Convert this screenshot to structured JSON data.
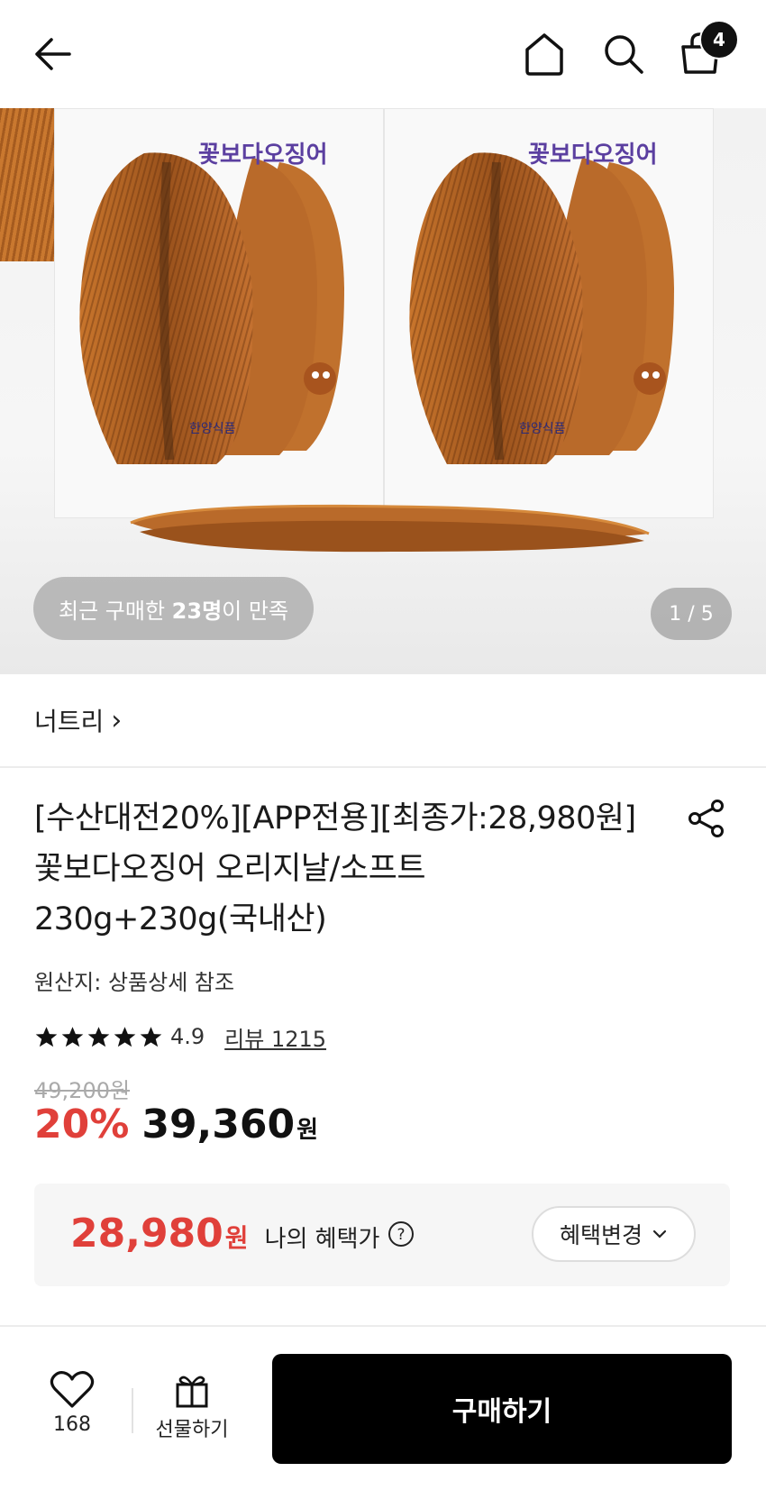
{
  "header": {
    "cart_count": "4"
  },
  "gallery": {
    "satisfied_prefix": "최근 구매한 ",
    "satisfied_count": "23명",
    "satisfied_suffix": "이 만족",
    "page_indicator": "1 / 5",
    "pack_brand_text": "꽃보다오징어",
    "pack_maker_text": "한양식품"
  },
  "brand": {
    "name": "너트리",
    "chevron": "›"
  },
  "product": {
    "title": "[수산대전20%][APP전용][최종가:28,980원]꽃보다오징어 오리지날/소프트 230g+230g(국내산)",
    "origin": "원산지: 상품상세 참조",
    "rating": "4.9",
    "rating_stars": 5,
    "review_link": "리뷰 1215",
    "original_price": "49,200원",
    "discount": "20%",
    "sale_price": "39,360",
    "currency": "원"
  },
  "benefit": {
    "price": "28,980",
    "currency": "원",
    "label": "나의 혜택가",
    "change_label": "혜택변경"
  },
  "bottom": {
    "like_count": "168",
    "gift_label": "선물하기",
    "buy_label": "구매하기"
  },
  "colors": {
    "accent_red": "#e0403a",
    "buy_button": "#000000"
  }
}
